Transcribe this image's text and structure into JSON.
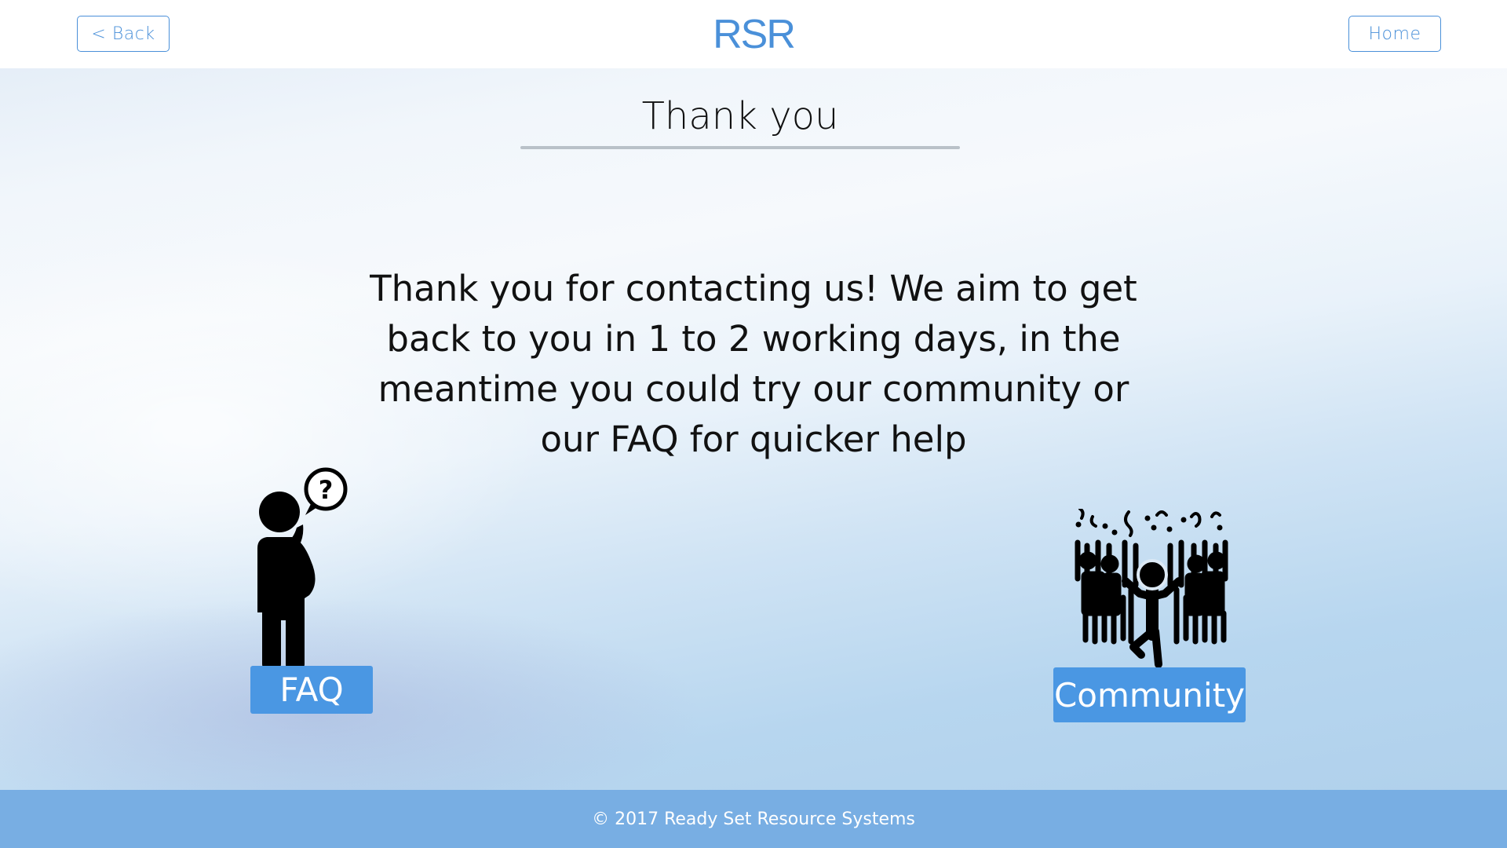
{
  "header": {
    "back_label": "< Back",
    "logo_text": "RSR",
    "home_label": "Home"
  },
  "main": {
    "title": "Thank you",
    "message": "Thank you for contacting us! We aim to get back to you in 1 to 2 working days, in the meantime you could try our community or our FAQ for quicker help"
  },
  "actions": {
    "faq": {
      "label": "FAQ",
      "icon": "thinking-person-icon"
    },
    "community": {
      "label": "Community",
      "icon": "celebrating-crowd-icon"
    }
  },
  "footer": {
    "copyright": "© 2017 Ready Set Resource Systems"
  },
  "colors": {
    "accent": "#4a90d9",
    "button_fill": "#4a97e3",
    "footer": "#78aee3",
    "text": "#111111"
  }
}
